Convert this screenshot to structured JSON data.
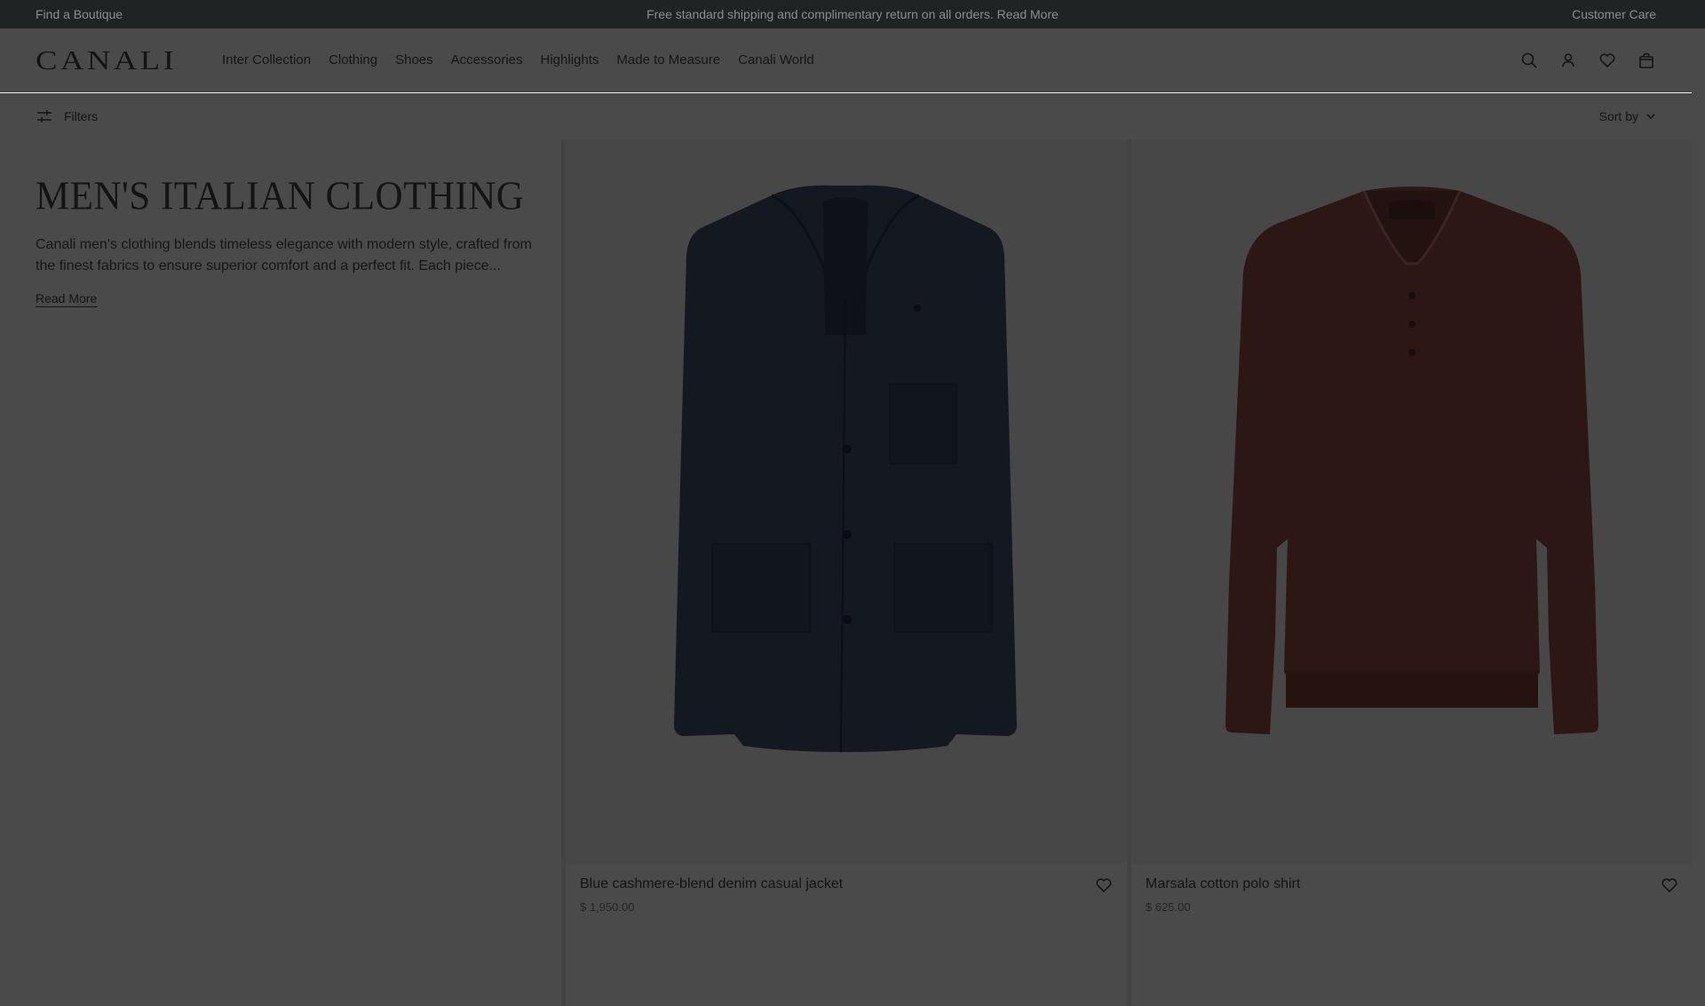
{
  "topbar": {
    "left_link": "Find a Boutique",
    "announcement": "Free standard shipping and complimentary return on all orders.",
    "announcement_link": "Read More",
    "right_link": "Customer Care"
  },
  "header": {
    "logo": "CANALI",
    "nav": [
      "Inter Collection",
      "Clothing",
      "Shoes",
      "Accessories",
      "Highlights",
      "Made to Measure",
      "Canali World"
    ],
    "icons": [
      "search-icon",
      "account-icon",
      "wishlist-icon",
      "bag-icon"
    ]
  },
  "filterbar": {
    "filters_label": "Filters",
    "sort_label": "Sort by"
  },
  "intro": {
    "title": "MEN'S ITALIAN CLOTHING",
    "description": "Canali men's clothing blends timeless elegance with modern style, crafted from the finest fabrics to ensure superior comfort and a perfect fit. Each piece...",
    "read_more": "Read More"
  },
  "products": [
    {
      "name": "Blue cashmere-blend denim casual jacket",
      "price": "$ 1,950.00",
      "color": "#141820"
    },
    {
      "name": "Marsala cotton polo shirt",
      "price": "$ 625.00",
      "color": "#2c1714"
    }
  ],
  "colors": {
    "overlay_background": "#4a4a4a",
    "topbar_background": "#1f2323"
  }
}
